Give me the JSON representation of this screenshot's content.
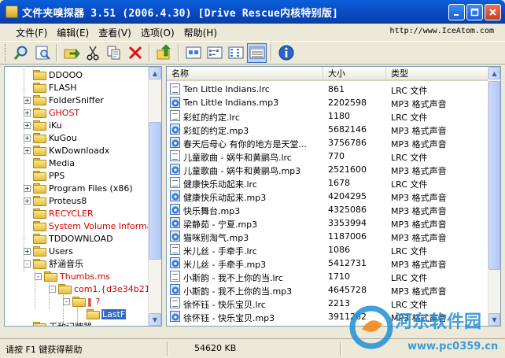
{
  "window": {
    "title": "文件夹嗅探器 3.51 (2006.4.30) [Drive Rescue内核特别版]"
  },
  "menu": {
    "items": [
      "文件(F)",
      "编辑(E)",
      "查看(V)",
      "选项(O)",
      "帮助(H)"
    ],
    "url": "http://www.IceAtom.com"
  },
  "toolbar": {
    "buttons": [
      "find-icon",
      "scan-icon",
      "export-icon",
      "cut-icon",
      "copy-icon",
      "delete-icon",
      "up-folder-icon",
      "large-icons-view-icon",
      "small-icons-view-icon",
      "list-view-icon",
      "details-view-icon",
      "about-icon"
    ]
  },
  "tree": {
    "items": [
      {
        "label": "DDOOO",
        "color": "normal"
      },
      {
        "label": "FLASH",
        "color": "normal"
      },
      {
        "label": "FolderSniffer",
        "color": "normal"
      },
      {
        "label": "GHOST",
        "color": "red"
      },
      {
        "label": "iKu",
        "color": "normal"
      },
      {
        "label": "KuGou",
        "color": "normal"
      },
      {
        "label": "KwDownloadx",
        "color": "normal"
      },
      {
        "label": "Media",
        "color": "normal"
      },
      {
        "label": "PPS",
        "color": "normal"
      },
      {
        "label": "Program Files (x86)",
        "color": "normal"
      },
      {
        "label": "Proteus8",
        "color": "normal"
      },
      {
        "label": "RECYCLER",
        "color": "red"
      },
      {
        "label": "System Volume Informati",
        "color": "red"
      },
      {
        "label": "TDDOWNLOAD",
        "color": "normal"
      },
      {
        "label": "Users",
        "color": "normal"
      },
      {
        "label": "舒涵音乐",
        "color": "normal"
      },
      {
        "label": "Thumbs.ms",
        "color": "red"
      },
      {
        "label": "com1.{d3e34b21",
        "color": "red"
      },
      {
        "label": "?",
        "color": "red"
      },
      {
        "label": "LastF",
        "color": "selected"
      },
      {
        "label": "无敌记牌器",
        "color": "normal"
      }
    ]
  },
  "list": {
    "columns": [
      "名称",
      "大小",
      "类型"
    ],
    "rows": [
      {
        "name": "Ten Little Indians.lrc",
        "size": "861",
        "type": "LRC 文件",
        "icon": "lrc"
      },
      {
        "name": "Ten Little Indians.mp3",
        "size": "2202598",
        "type": "MP3 格式声音",
        "icon": "mp3"
      },
      {
        "name": "彩虹的约定.lrc",
        "size": "1180",
        "type": "LRC 文件",
        "icon": "lrc"
      },
      {
        "name": "彩虹的约定.mp3",
        "size": "5682146",
        "type": "MP3 格式声音",
        "icon": "mp3"
      },
      {
        "name": "春天后母心 有你的地方是天堂...",
        "size": "3756786",
        "type": "MP3 格式声音",
        "icon": "mp3"
      },
      {
        "name": "儿童歌曲 - 娲牛和黄鹂鸟.lrc",
        "size": "770",
        "type": "LRC 文件",
        "icon": "lrc"
      },
      {
        "name": "儿童歌曲 - 娲牛和黄鹂鸟.mp3",
        "size": "2521600",
        "type": "MP3 格式声音",
        "icon": "mp3"
      },
      {
        "name": "健康快乐动起来.lrc",
        "size": "1678",
        "type": "LRC 文件",
        "icon": "lrc"
      },
      {
        "name": "健康快乐动起来.mp3",
        "size": "4204295",
        "type": "MP3 格式声音",
        "icon": "mp3"
      },
      {
        "name": "快乐舞台.mp3",
        "size": "4325086",
        "type": "MP3 格式声音",
        "icon": "mp3"
      },
      {
        "name": "梁静茹 - 宁夏.mp3",
        "size": "3353994",
        "type": "MP3 格式声音",
        "icon": "mp3"
      },
      {
        "name": "猫咪别淘气.mp3",
        "size": "1187006",
        "type": "MP3 格式声音",
        "icon": "mp3"
      },
      {
        "name": "米儿丝 - 手牵手.lrc",
        "size": "1086",
        "type": "LRC 文件",
        "icon": "lrc"
      },
      {
        "name": "米儿丝 - 手牵手.mp3",
        "size": "5412731",
        "type": "MP3 格式声音",
        "icon": "mp3"
      },
      {
        "name": "小斯韵 - 我不上你的当.lrc",
        "size": "1710",
        "type": "LRC 文件",
        "icon": "lrc"
      },
      {
        "name": "小斯韵 - 我不上你的当.mp3",
        "size": "4645728",
        "type": "MP3 格式声音",
        "icon": "mp3"
      },
      {
        "name": "徐怀钰 - 快乐宝贝.lrc",
        "size": "2213",
        "type": "LRC 文件",
        "icon": "lrc"
      },
      {
        "name": "徐怀钰 - 快乐宝贝.mp3",
        "size": "3911262",
        "type": "MP3 格式声音",
        "icon": "mp3"
      }
    ]
  },
  "status": {
    "hint": "请按 F1 键获得帮助",
    "size": "54620 KB"
  },
  "watermark": {
    "line1": "河东软件园",
    "line2": "www.pc0359.cn"
  }
}
